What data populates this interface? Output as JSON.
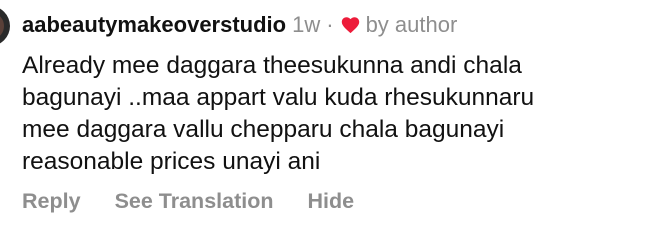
{
  "comment": {
    "username": "aabeautymakeoverstudio",
    "timestamp": "1w",
    "separator": "·",
    "liked_by_author_icon": "heart-icon",
    "liked_by_author_color": "#ed1c3a",
    "liked_by_author_label": "by author",
    "body_lines": [
      "Already mee daggara theesukunna andi chala",
      "bagunayi ..maa appart valu kuda rhesukunnaru",
      "mee daggara vallu chepparu chala bagunayi",
      "reasonable prices unayi ani"
    ]
  },
  "actions": {
    "reply_label": "Reply",
    "see_translation_label": "See Translation",
    "hide_label": "Hide"
  },
  "colors": {
    "text_primary": "#111111",
    "text_secondary": "#8e8e8e"
  }
}
